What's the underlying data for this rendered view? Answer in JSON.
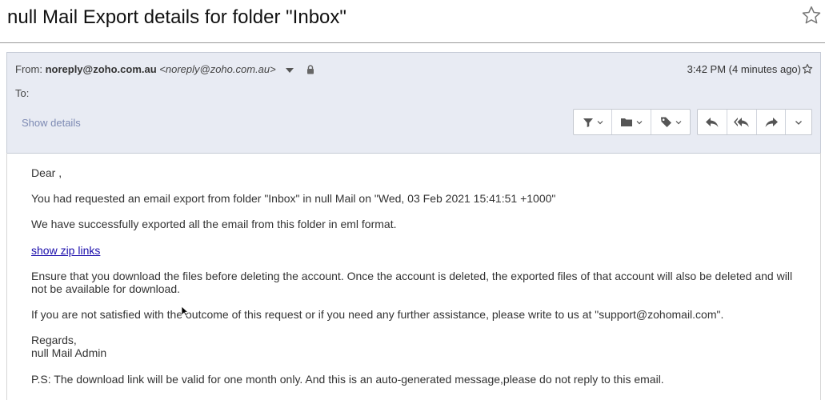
{
  "subject": "null Mail Export details for folder \"Inbox\"",
  "header": {
    "from_label": "From:",
    "sender_address": "noreply@zoho.com.au",
    "sender_display": "<noreply@zoho.com.au>",
    "to_label": "To:",
    "show_details": "Show details",
    "time": "3:42 PM (4 minutes ago)"
  },
  "toolbar": {
    "left_icons": [
      "filter-icon",
      "folder-icon",
      "tag-icon"
    ],
    "right_icons": [
      "reply-icon",
      "reply-all-icon",
      "forward-icon",
      "more-icon"
    ]
  },
  "body": {
    "greeting": "Dear           ,",
    "line1": "You had requested an email export from folder \"Inbox\" in null Mail on \"Wed, 03 Feb 2021 15:41:51 +1000\"",
    "line2": "We have successfully exported all the email from this folder in eml format.",
    "link": "show zip links",
    "line3a": "Ensure that you download the files before deleting the account. Once the account is deleted, the exported files of that account will also be deleted and will",
    "line3b": "not be available for download.",
    "line4": "If you are not satisfied with the outcome of this request or if you need any further assistance, please write to us at \"support@zohomail.com\".",
    "regards": "Regards,",
    "signature": "null Mail Admin",
    "ps": "P.S: The download link will be valid for one month only. And this is an auto-generated message,please do not reply to this email."
  },
  "colors": {
    "header_bg": "#e8ebf3",
    "link": "#1a0dab",
    "show_details": "#7d8ab3"
  }
}
